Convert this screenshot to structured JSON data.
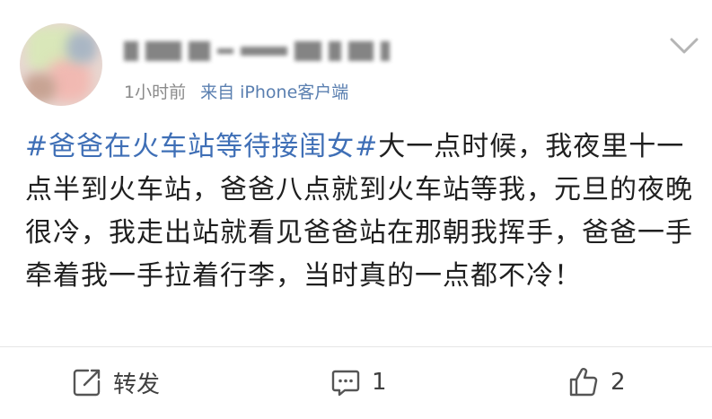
{
  "post": {
    "meta": {
      "time": "1小时前",
      "source": "来自 iPhone客户端"
    },
    "content": {
      "hashtag": "#爸爸在火车站等待接闺女#",
      "text": "大一点时候，我夜里十一点半到火车站，爸爸八点就到火车站等我，元旦的夜晚很冷，我走出站就看见爸爸站在那朝我挥手，爸爸一手牵着我一手拉着行李，当时真的一点都不冷！"
    },
    "actions": {
      "repost_label": "转发",
      "comment_count": "1",
      "like_count": "2"
    },
    "icons": {
      "menu": "chevron-down-icon",
      "repost": "repost-icon",
      "comment": "comment-icon",
      "like": "thumbs-up-icon"
    }
  }
}
